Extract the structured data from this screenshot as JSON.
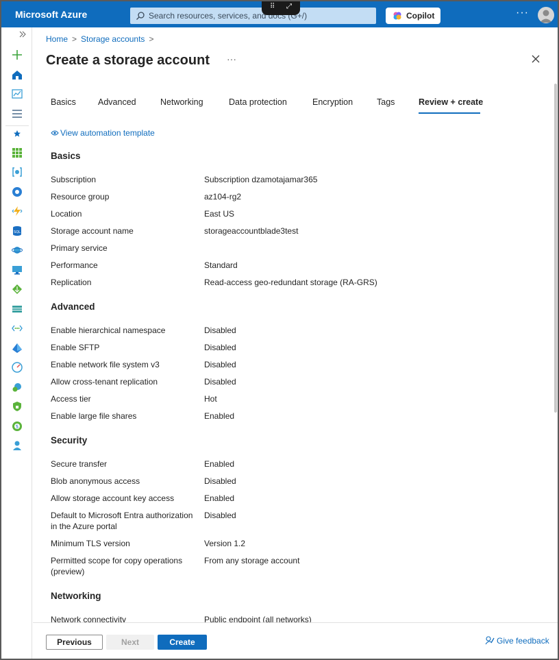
{
  "topbar": {
    "brand": "Microsoft Azure",
    "search_placeholder": "Search resources, services, and docs (G+/)",
    "copilot_label": "Copilot",
    "more_label": "···"
  },
  "breadcrumb": {
    "home": "Home",
    "storage_accounts": "Storage accounts",
    "sep": ">"
  },
  "page": {
    "title": "Create a storage account",
    "more_label": "···"
  },
  "tabs": [
    {
      "label": "Basics",
      "active": false
    },
    {
      "label": "Advanced",
      "active": false
    },
    {
      "label": "Networking",
      "active": false
    },
    {
      "label": "Data protection",
      "active": false
    },
    {
      "label": "Encryption",
      "active": false
    },
    {
      "label": "Tags",
      "active": false
    },
    {
      "label": "Review + create",
      "active": true
    }
  ],
  "automation_link": "View automation template",
  "sections": {
    "basics": {
      "heading": "Basics",
      "rows": [
        {
          "label": "Subscription",
          "value": "Subscription dzamotajamar365"
        },
        {
          "label": "Resource group",
          "value": "az104-rg2"
        },
        {
          "label": "Location",
          "value": "East US"
        },
        {
          "label": "Storage account name",
          "value": "storageaccountblade3test"
        },
        {
          "label": "Primary service",
          "value": ""
        },
        {
          "label": "Performance",
          "value": "Standard"
        },
        {
          "label": "Replication",
          "value": "Read-access geo-redundant storage (RA-GRS)"
        }
      ]
    },
    "advanced": {
      "heading": "Advanced",
      "rows": [
        {
          "label": "Enable hierarchical namespace",
          "value": "Disabled"
        },
        {
          "label": "Enable SFTP",
          "value": "Disabled"
        },
        {
          "label": "Enable network file system v3",
          "value": "Disabled"
        },
        {
          "label": "Allow cross-tenant replication",
          "value": "Disabled"
        },
        {
          "label": "Access tier",
          "value": "Hot"
        },
        {
          "label": "Enable large file shares",
          "value": "Enabled"
        }
      ]
    },
    "security": {
      "heading": "Security",
      "rows": [
        {
          "label": "Secure transfer",
          "value": "Enabled"
        },
        {
          "label": "Blob anonymous access",
          "value": "Disabled"
        },
        {
          "label": "Allow storage account key access",
          "value": "Enabled"
        },
        {
          "label": "Default to Microsoft Entra authorization in the Azure portal",
          "value": "Disabled"
        },
        {
          "label": "Minimum TLS version",
          "value": "Version 1.2"
        },
        {
          "label": "Permitted scope for copy operations (preview)",
          "value": "From any storage account"
        }
      ]
    },
    "networking": {
      "heading": "Networking",
      "rows": [
        {
          "label": "Network connectivity",
          "value": "Public endpoint (all networks)"
        }
      ]
    }
  },
  "footer": {
    "previous": "Previous",
    "next": "Next",
    "create": "Create",
    "feedback": "Give feedback"
  },
  "colors": {
    "accent": "#0f6cbd",
    "topbar": "#0f6cbd"
  }
}
